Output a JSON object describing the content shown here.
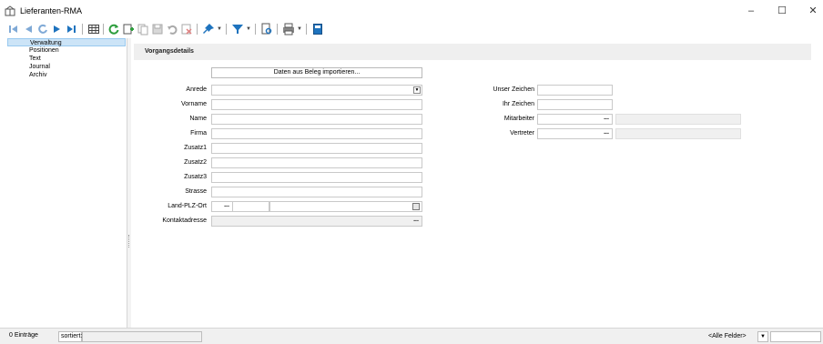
{
  "window": {
    "title": "Lieferanten-RMA",
    "minimize": "–",
    "maximize": "☐",
    "close": "✕"
  },
  "nav": {
    "items": [
      {
        "label": "Verwaltung",
        "selected": true
      },
      {
        "label": "Positionen",
        "selected": false
      },
      {
        "label": "Text",
        "selected": false
      },
      {
        "label": "Journal",
        "selected": false
      },
      {
        "label": "Archiv",
        "selected": false
      }
    ]
  },
  "section": {
    "title": "Vorgangsdetails",
    "import_button": "Daten aus Beleg importieren..."
  },
  "form_left": {
    "anrede": "Anrede",
    "vorname": "Vorname",
    "name": "Name",
    "firma": "Firma",
    "zusatz1": "Zusatz1",
    "zusatz2": "Zusatz2",
    "zusatz3": "Zusatz3",
    "strasse": "Strasse",
    "land_plz_ort": "Land-PLZ-Ort",
    "kontaktadresse": "Kontaktadresse"
  },
  "form_right": {
    "unser_zeichen": "Unser Zeichen",
    "ihr_zeichen": "Ihr Zeichen",
    "mitarbeiter": "Mitarbeiter",
    "vertreter": "Vertreter"
  },
  "buttons": {
    "dots": "...",
    "dropdown_arrow": "▼"
  },
  "statusbar": {
    "entries": "0 Einträge",
    "sorted": "sortiert:",
    "field_filter": "<Alle Felder>"
  },
  "colors": {
    "accent_blue": "#1e73be",
    "selection": "#cce4f7",
    "green": "#2e9e3e"
  }
}
